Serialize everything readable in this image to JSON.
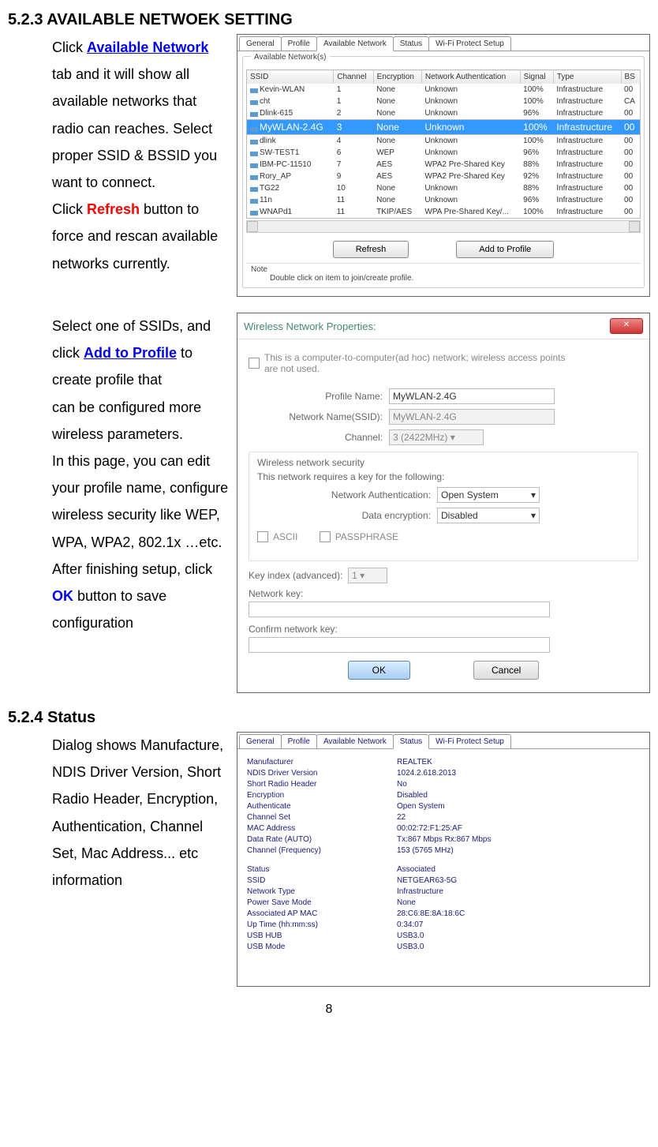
{
  "sections": {
    "title1": "5.2.3 AVAILABLE NETWOEK SETTING",
    "title2": "5.2.4 Status"
  },
  "para1": {
    "t1": "Click ",
    "link1": "Available Network",
    "t2": " tab and it will show all available networks that radio can reaches. Select proper SSID & BSSID you want to connect.",
    "t3": "Click ",
    "red1": "Refresh",
    "t4": " button to force and rescan available networks currently."
  },
  "para2": {
    "t1": "Select one of SSIDs, and click ",
    "link1": "Add to Profile",
    "t2": " to create profile that",
    "t3": "can be configured more wireless parameters.",
    "t4": "In this page, you can edit your profile name, configure wireless security like WEP, WPA, WPA2, 802.1x …etc. After finishing setup, click ",
    "ok": "OK",
    "t5": " button to save configuration"
  },
  "para3": "Dialog shows Manufacture, NDIS Driver Version, Short Radio Header, Encryption, Authentication, Channel Set, Mac Address... etc information",
  "pagenum": "8",
  "shot1": {
    "tabs": [
      "General",
      "Profile",
      "Available Network",
      "Status",
      "Wi-Fi Protect Setup"
    ],
    "active_tab": 2,
    "group_title": "Available Network(s)",
    "headers": [
      "SSID",
      "Channel",
      "Encryption",
      "Network Authentication",
      "Signal",
      "Type",
      "BS"
    ],
    "rows": [
      {
        "ssid": "Kevin-WLAN",
        "ch": "1",
        "enc": "None",
        "auth": "Unknown",
        "sig": "100%",
        "type": "Infrastructure",
        "bs": "00"
      },
      {
        "ssid": "cht",
        "ch": "1",
        "enc": "None",
        "auth": "Unknown",
        "sig": "100%",
        "type": "Infrastructure",
        "bs": "CA"
      },
      {
        "ssid": "Dlink-615",
        "ch": "2",
        "enc": "None",
        "auth": "Unknown",
        "sig": "96%",
        "type": "Infrastructure",
        "bs": "00"
      },
      {
        "ssid": "MyWLAN-2.4G",
        "ch": "3",
        "enc": "None",
        "auth": "Unknown",
        "sig": "100%",
        "type": "Infrastructure",
        "bs": "00",
        "sel": true
      },
      {
        "ssid": "dlink",
        "ch": "4",
        "enc": "None",
        "auth": "Unknown",
        "sig": "100%",
        "type": "Infrastructure",
        "bs": "00"
      },
      {
        "ssid": "SW-TEST1",
        "ch": "6",
        "enc": "WEP",
        "auth": "Unknown",
        "sig": "96%",
        "type": "Infrastructure",
        "bs": "00"
      },
      {
        "ssid": "IBM-PC-11510",
        "ch": "7",
        "enc": "AES",
        "auth": "WPA2 Pre-Shared Key",
        "sig": "88%",
        "type": "Infrastructure",
        "bs": "00"
      },
      {
        "ssid": "Rory_AP",
        "ch": "9",
        "enc": "AES",
        "auth": "WPA2 Pre-Shared Key",
        "sig": "92%",
        "type": "Infrastructure",
        "bs": "00"
      },
      {
        "ssid": "TG22",
        "ch": "10",
        "enc": "None",
        "auth": "Unknown",
        "sig": "88%",
        "type": "Infrastructure",
        "bs": "00"
      },
      {
        "ssid": "11n",
        "ch": "11",
        "enc": "None",
        "auth": "Unknown",
        "sig": "96%",
        "type": "Infrastructure",
        "bs": "00"
      },
      {
        "ssid": "WNAPd1",
        "ch": "11",
        "enc": "TKIP/AES",
        "auth": "WPA Pre-Shared Key/...",
        "sig": "100%",
        "type": "Infrastructure",
        "bs": "00"
      }
    ],
    "btn_refresh": "Refresh",
    "btn_add": "Add to Profile",
    "note_label": "Note",
    "note_text": "Double click on item to join/create profile."
  },
  "shot2": {
    "title": "Wireless Network Properties:",
    "adhoc": "This is a computer-to-computer(ad hoc) network; wireless access points are not used.",
    "profile_label": "Profile Name:",
    "profile_value": "MyWLAN-2.4G",
    "ssid_label": "Network Name(SSID):",
    "ssid_value": "MyWLAN-2.4G",
    "channel_label": "Channel:",
    "channel_value": "3  (2422MHz)",
    "sec_title": "Wireless network security",
    "sec_desc": "This network requires a key for the following:",
    "auth_label": "Network Authentication:",
    "auth_value": "Open System",
    "enc_label": "Data encryption:",
    "enc_value": "Disabled",
    "ascii": "ASCII",
    "passphrase": "PASSPHRASE",
    "keyidx_label": "Key index (advanced):",
    "keyidx_value": "1",
    "netkey_label": "Network key:",
    "confirm_label": "Confirm network key:",
    "ok": "OK",
    "cancel": "Cancel"
  },
  "shot3": {
    "tabs": [
      "General",
      "Profile",
      "Available Network",
      "Status",
      "Wi-Fi Protect Setup"
    ],
    "active_tab": 3,
    "rows1": [
      {
        "k": "Manufacturer",
        "v": "REALTEK"
      },
      {
        "k": "NDIS Driver Version",
        "v": "1024.2.618.2013"
      },
      {
        "k": "Short Radio Header",
        "v": "No"
      },
      {
        "k": "Encryption",
        "v": "Disabled"
      },
      {
        "k": "Authenticate",
        "v": "Open System"
      },
      {
        "k": "Channel Set",
        "v": "22"
      },
      {
        "k": "MAC Address",
        "v": "00:02:72:F1:25:AF"
      },
      {
        "k": "Data Rate (AUTO)",
        "v": "Tx:867 Mbps Rx:867 Mbps"
      },
      {
        "k": "Channel (Frequency)",
        "v": "153 (5765 MHz)"
      }
    ],
    "rows2": [
      {
        "k": "Status",
        "v": "Associated"
      },
      {
        "k": "SSID",
        "v": "NETGEAR63-5G"
      },
      {
        "k": "Network Type",
        "v": "Infrastructure"
      },
      {
        "k": "Power Save Mode",
        "v": "None"
      },
      {
        "k": "Associated AP MAC",
        "v": "28:C6:8E:8A:18:6C"
      },
      {
        "k": "Up Time (hh:mm:ss)",
        "v": "0:34:07"
      },
      {
        "k": "USB HUB",
        "v": "USB3.0"
      },
      {
        "k": "USB Mode",
        "v": "USB3.0"
      }
    ]
  }
}
